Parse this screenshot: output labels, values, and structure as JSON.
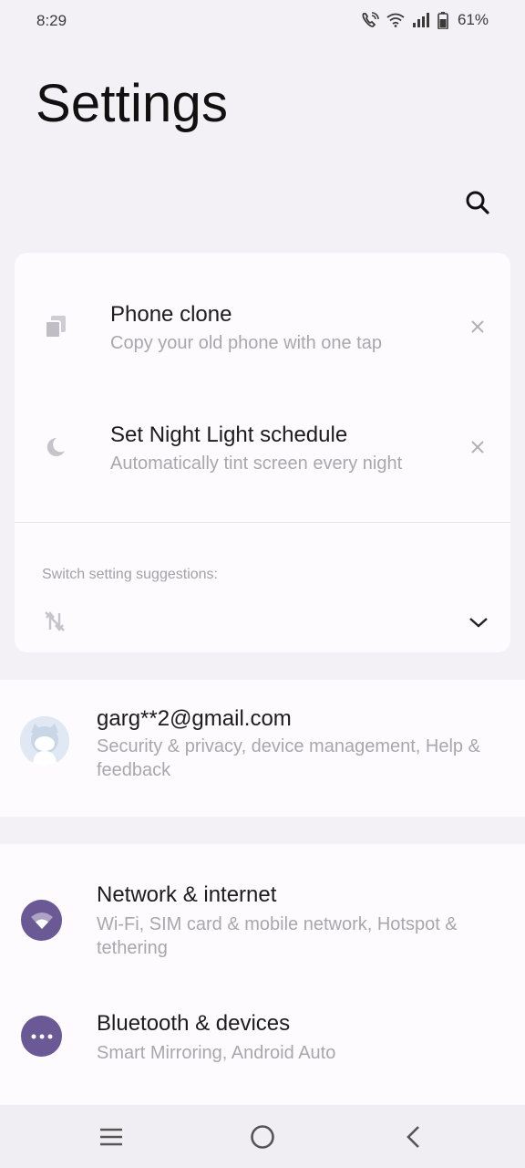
{
  "status_bar": {
    "time": "8:29",
    "battery": "61%",
    "icons": [
      "wifi-calling-icon",
      "wifi-icon",
      "signal-icon",
      "battery-icon"
    ]
  },
  "header": {
    "title": "Settings",
    "search_icon": "search-icon"
  },
  "suggestions": {
    "items": [
      {
        "title": "Phone clone",
        "subtitle": "Copy your old phone with one tap",
        "icon": "phone-clone-icon"
      },
      {
        "title": "Set Night Light schedule",
        "subtitle": "Automatically tint screen every night",
        "icon": "moon-icon"
      }
    ],
    "switch_label": "Switch setting suggestions:"
  },
  "account": {
    "email": "garg**2@gmail.com",
    "subtitle": "Security & privacy, device management, Help & feedback"
  },
  "settings": [
    {
      "title": "Network & internet",
      "subtitle": "Wi-Fi, SIM card & mobile network, Hotspot & tethering",
      "icon": "wifi-icon"
    },
    {
      "title": "Bluetooth & devices",
      "subtitle": "Smart Mirroring, Android Auto",
      "icon": "more-dots-icon"
    }
  ],
  "colors": {
    "accent": "#6a5994",
    "background": "#f3f1f6",
    "card": "#fdfbfe",
    "secondary_text": "#a9a7ad"
  }
}
